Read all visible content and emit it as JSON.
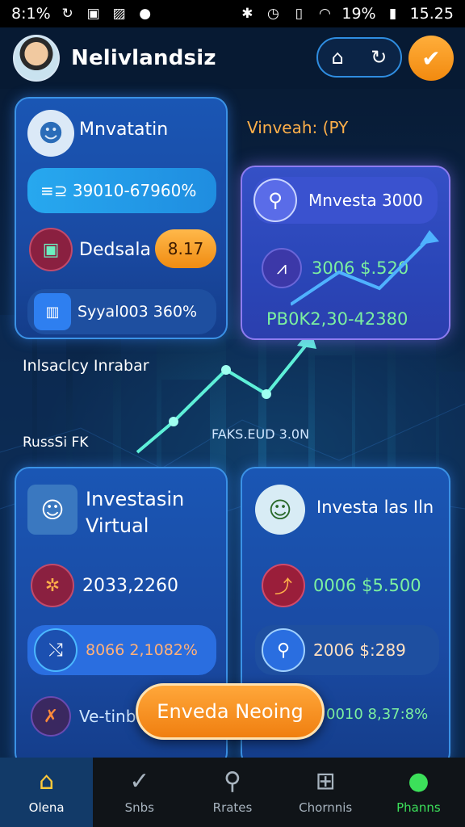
{
  "status_bar": {
    "left_text": "8:1%",
    "signal_text": "19%",
    "time": "15.25"
  },
  "header": {
    "username": "Nelivlandsiz",
    "pill_icons": [
      "home-icon",
      "refresh-icon"
    ],
    "action_icon": "check-icon"
  },
  "card1": {
    "title": "Mnvatatin",
    "row1_value": "≡⊇ 39010-67960%",
    "row2_label": "Dedsala",
    "row2_badge": "8.17",
    "row3_value": "Syyal003 360%"
  },
  "floating": {
    "label_top_right": "Vinveah: (PY",
    "label_left_mid": "Inlsaclcy Inrabar",
    "label_left_low": "RussSi FK",
    "label_chart": "FAKS.EUD 3.0N"
  },
  "card2": {
    "title": "Mnvesta 3000",
    "row1_value": "3006 $.520",
    "row2_value": "PB0K2,30-42380"
  },
  "card3": {
    "title": "Investasin\nVirtual",
    "title_line1": "Investasin",
    "title_line2": "Virtual",
    "row1_value": "2033,2260",
    "row2_value": "8066 2,1082%",
    "row3_label": "Ve-tinb"
  },
  "card4": {
    "title": "Investa las Iln",
    "row1_value": "0006 $5.500",
    "row2_value": "2006 $:289",
    "row3_value": "0010 8,37:8%"
  },
  "cta": {
    "label": "Enveda Neoing"
  },
  "nav": [
    {
      "label": "Olena",
      "icon": "home-icon",
      "active": true
    },
    {
      "label": "Snbs",
      "icon": "check-circle-icon"
    },
    {
      "label": "Rrates",
      "icon": "search-icon"
    },
    {
      "label": "Chornnis",
      "icon": "plus-square-icon"
    },
    {
      "label": "Phanns",
      "icon": "user-icon"
    }
  ],
  "colors": {
    "accent_orange": "#f28a0f",
    "value_green": "#7cf0a0",
    "card_blue": "#1a56b4",
    "nav_active": "#123a68"
  }
}
